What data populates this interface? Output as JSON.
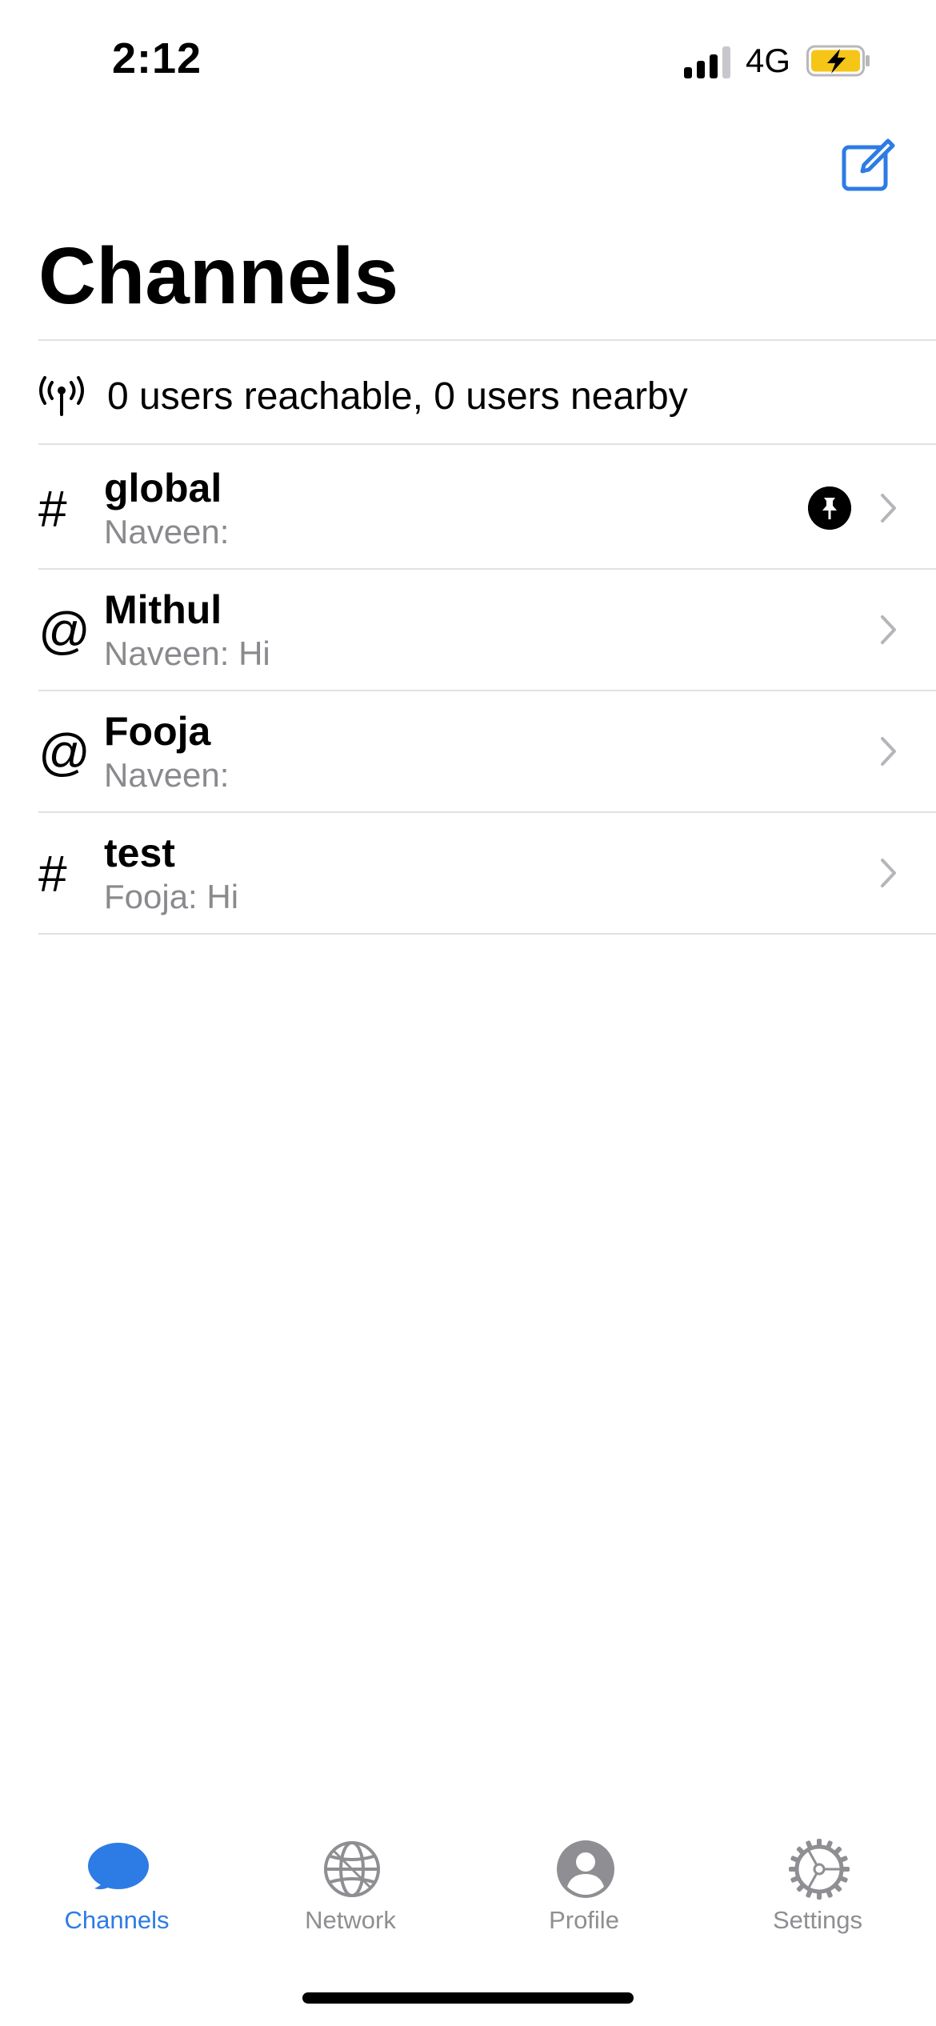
{
  "status_bar": {
    "time": "2:12",
    "network": "4G",
    "battery_color": "#f5c518"
  },
  "header": {
    "title": "Channels",
    "compose_icon": "compose-icon"
  },
  "reachability": {
    "icon": "antenna-icon",
    "text": "0 users reachable, 0 users nearby"
  },
  "channels": [
    {
      "symbol": "#",
      "name": "global",
      "preview": "Naveen:",
      "pinned": true
    },
    {
      "symbol": "@",
      "name": "Mithul",
      "preview": "Naveen: Hi",
      "pinned": false
    },
    {
      "symbol": "@",
      "name": "Fooja",
      "preview": "Naveen:",
      "pinned": false
    },
    {
      "symbol": "#",
      "name": "test",
      "preview": "Fooja: Hi",
      "pinned": false
    }
  ],
  "tabs": [
    {
      "label": "Channels",
      "icon": "chat-bubble-icon",
      "active": true
    },
    {
      "label": "Network",
      "icon": "globe-icon",
      "active": false
    },
    {
      "label": "Profile",
      "icon": "profile-icon",
      "active": false
    },
    {
      "label": "Settings",
      "icon": "gear-icon",
      "active": false
    }
  ],
  "colors": {
    "accent": "#2d7be5",
    "inactive": "#8e8e93",
    "secondary_text": "#8a8a8e",
    "divider": "#e0e0e5"
  }
}
